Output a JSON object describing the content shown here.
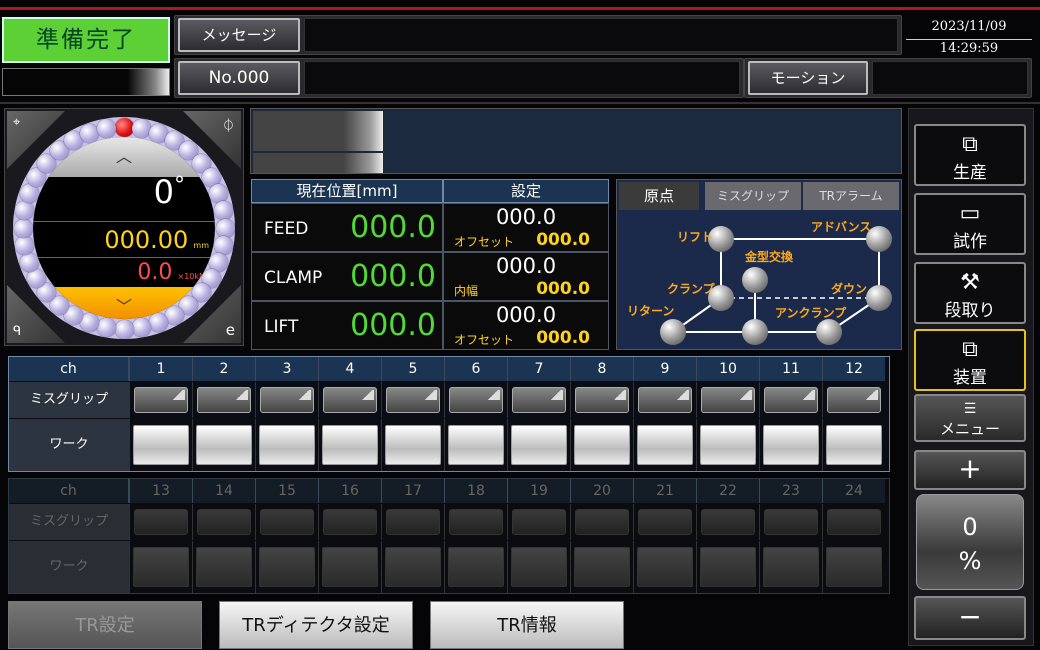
{
  "header": {
    "status": "準備完了",
    "message_label": "メッセージ",
    "number_label": "No.000",
    "motion_label": "モーション",
    "date": "2023/11/09",
    "time": "14:29:59"
  },
  "dial": {
    "angle": "0",
    "angle_unit": "°",
    "value1": "000.00",
    "unit1": "mm",
    "value2": "0.0",
    "unit2": "×10kN",
    "up_arrow": "︿",
    "down_arrow": "﹀",
    "tl_icon": "⌖",
    "tr_icon": "⏀",
    "bl_icon": "ᑫ",
    "br_icon": "e"
  },
  "position": {
    "header": "現在位置[mm]",
    "set_header": "設定",
    "rows": [
      {
        "name": "FEED",
        "value": "000.0",
        "set": "000.0",
        "sub_label": "オフセット",
        "sub_value": "000.0"
      },
      {
        "name": "CLAMP",
        "value": "000.0",
        "set": "000.0",
        "sub_label": "内幅",
        "sub_value": "000.0"
      },
      {
        "name": "LIFT",
        "value": "000.0",
        "set": "000.0",
        "sub_label": "オフセット",
        "sub_value": "000.0"
      }
    ]
  },
  "motion_tabs": [
    "原点",
    "ミスグリップ",
    "TRアラーム"
  ],
  "motion_labels": {
    "lift": "リフト",
    "advance": "アドバンス",
    "die_change": "金型交換",
    "clamp": "クランプ",
    "down": "ダウン",
    "return": "リターン",
    "unclamp": "アンクランプ"
  },
  "table1": {
    "ch": "ch",
    "row1": "ミスグリップ",
    "row2": "ワーク",
    "channels": [
      "1",
      "2",
      "3",
      "4",
      "5",
      "6",
      "7",
      "8",
      "9",
      "10",
      "11",
      "12"
    ]
  },
  "table2": {
    "ch": "ch",
    "row1": "ミスグリップ",
    "row2": "ワーク",
    "channels": [
      "13",
      "14",
      "15",
      "16",
      "17",
      "18",
      "19",
      "20",
      "21",
      "22",
      "23",
      "24"
    ]
  },
  "side": {
    "production": "生産",
    "trial": "試作",
    "setup": "段取り",
    "device": "装置",
    "menu": "メニュー",
    "plus": "+",
    "percent_value": "0",
    "percent_unit": "%",
    "minus": "−"
  },
  "bottom": {
    "tr_setting": "TR設定",
    "tr_detector": "TRディテクタ設定",
    "tr_info": "TR情報"
  }
}
